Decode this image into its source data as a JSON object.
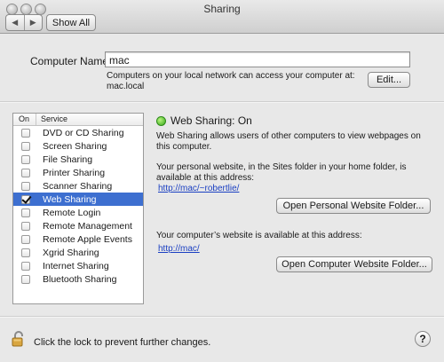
{
  "window": {
    "title": "Sharing",
    "back_icon": "◀",
    "forward_icon": "▶",
    "show_all_label": "Show All"
  },
  "computer_name": {
    "label": "Computer Name:",
    "value": "mac",
    "description": "Computers on your local network can access your computer at:",
    "local_address": "mac.local",
    "edit_label": "Edit..."
  },
  "services": {
    "header_on": "On",
    "header_service": "Service",
    "items": [
      {
        "label": "DVD or CD Sharing",
        "checked": false,
        "selected": false
      },
      {
        "label": "Screen Sharing",
        "checked": false,
        "selected": false
      },
      {
        "label": "File Sharing",
        "checked": false,
        "selected": false
      },
      {
        "label": "Printer Sharing",
        "checked": false,
        "selected": false
      },
      {
        "label": "Scanner Sharing",
        "checked": false,
        "selected": false
      },
      {
        "label": "Web Sharing",
        "checked": true,
        "selected": true
      },
      {
        "label": "Remote Login",
        "checked": false,
        "selected": false
      },
      {
        "label": "Remote Management",
        "checked": false,
        "selected": false
      },
      {
        "label": "Remote Apple Events",
        "checked": false,
        "selected": false
      },
      {
        "label": "Xgrid Sharing",
        "checked": false,
        "selected": false
      },
      {
        "label": "Internet Sharing",
        "checked": false,
        "selected": false
      },
      {
        "label": "Bluetooth Sharing",
        "checked": false,
        "selected": false
      }
    ]
  },
  "detail": {
    "status": "Web Sharing: On",
    "status_color": "#38a81b",
    "description": "Web Sharing allows users of other computers to view webpages on this computer.",
    "personal_text": "Your personal website, in the Sites folder in your home folder, is available at this address:",
    "personal_link": "http://mac/~robertlie/",
    "open_personal_label": "Open Personal Website Folder...",
    "computer_text": "Your computer’s website is available at this address:",
    "computer_link": "http://mac/",
    "open_computer_label": "Open Computer Website Folder..."
  },
  "footer": {
    "lock_text": "Click the lock to prevent further changes.",
    "help_label": "?"
  }
}
